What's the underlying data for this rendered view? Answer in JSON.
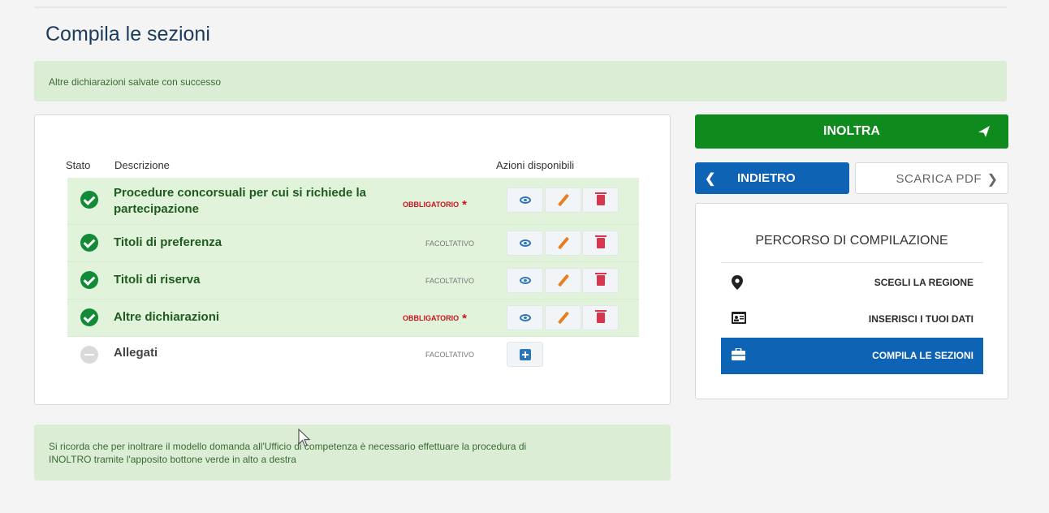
{
  "page": {
    "title": "Compila le sezioni"
  },
  "alerts": {
    "success": "Altre dichiarazioni salvate con successo",
    "note_line1": "Si ricorda che per inoltrare il modello domanda all'Ufficio di competenza è necessario effettuare la procedura di",
    "note_line2": "INOLTRO tramite l'apposito bottone verde in alto a destra"
  },
  "table": {
    "headers": {
      "stato": "Stato",
      "descrizione": "Descrizione",
      "azioni": "Azioni disponibili"
    },
    "rows": [
      {
        "status": "completed",
        "description_line1": "Procedure concorsuali per cui si richiede la",
        "description_line2": "partecipazione",
        "requirement": "OBBLIGATORIO",
        "required": true,
        "actions": [
          "eye-icon",
          "pencil-icon",
          "trash-icon"
        ]
      },
      {
        "status": "completed",
        "description": "Titoli di preferenza",
        "requirement": "FACOLTATIVO",
        "required": false,
        "actions": [
          "eye-icon",
          "pencil-icon",
          "trash-icon"
        ]
      },
      {
        "status": "completed",
        "description": "Titoli di riserva",
        "requirement": "FACOLTATIVO",
        "required": false,
        "actions": [
          "eye-icon",
          "pencil-icon",
          "trash-icon"
        ]
      },
      {
        "status": "completed",
        "description": "Altre dichiarazioni",
        "requirement": "OBBLIGATORIO",
        "required": true,
        "actions": [
          "eye-icon",
          "pencil-icon",
          "trash-icon"
        ]
      },
      {
        "status": "empty",
        "description": "Allegati",
        "requirement": "FACOLTATIVO",
        "required": false,
        "actions": [
          "plus-square-icon"
        ]
      }
    ],
    "required_marker": "*"
  },
  "sidebar": {
    "inoltra_label": "INOLTRA",
    "indietro_label": "INDIETRO",
    "scarica_pdf_label": "SCARICA PDF",
    "percorso_title": "PERCORSO DI COMPILAZIONE",
    "steps": [
      {
        "label": "SCEGLI LA REGIONE",
        "icon": "map-marker-icon",
        "active": false
      },
      {
        "label": "INSERISCI I TUOI DATI",
        "icon": "id-card-icon",
        "active": false
      },
      {
        "label": "COMPILA LE SEZIONI",
        "icon": "briefcase-icon",
        "active": true
      }
    ]
  },
  "colors": {
    "success_green": "#0f8a1d",
    "primary_blue": "#0f63b5",
    "required_red": "#c9151e",
    "row_done_bg": "#e2f3dc",
    "alert_bg": "#dcedd5"
  }
}
